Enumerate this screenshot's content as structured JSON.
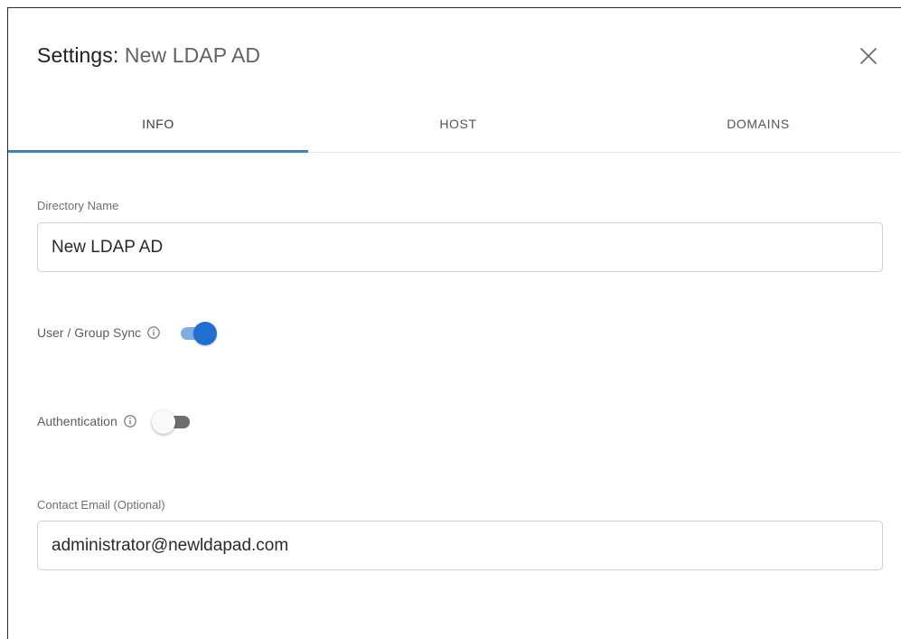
{
  "dialog": {
    "title_prefix": "Settings:",
    "title_name": "New LDAP AD",
    "close_icon": "close-icon"
  },
  "tabs": [
    {
      "label": "INFO",
      "active": true
    },
    {
      "label": "HOST",
      "active": false
    },
    {
      "label": "DOMAINS",
      "active": false
    }
  ],
  "form": {
    "directory_name": {
      "label": "Directory Name",
      "value": "New LDAP AD"
    },
    "user_group_sync": {
      "label": "User / Group Sync",
      "enabled": true
    },
    "authentication": {
      "label": "Authentication",
      "enabled": false
    },
    "contact_email": {
      "label": "Contact Email (Optional)",
      "value": "administrator@newldapad.com"
    }
  },
  "colors": {
    "accent": "#1f6fd1",
    "tab_indicator": "#3b82c4"
  }
}
